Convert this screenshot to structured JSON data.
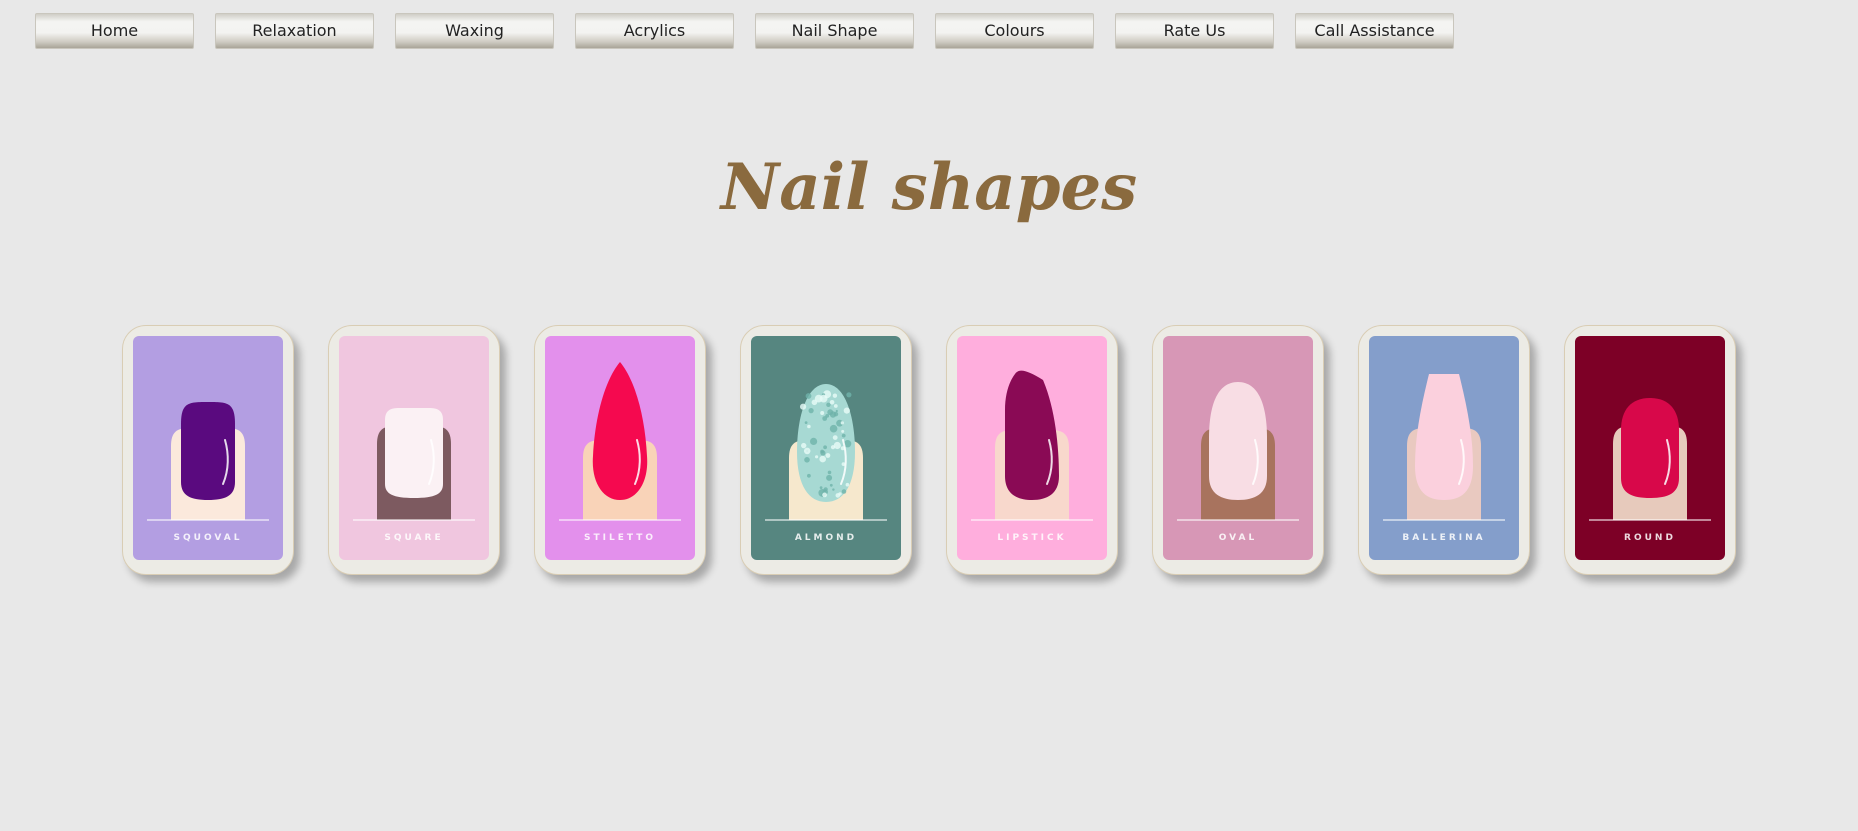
{
  "nav": {
    "items": [
      "Home",
      "Relaxation",
      "Waxing",
      "Acrylics",
      "Nail Shape",
      "Colours",
      "Rate Us",
      "Call Assistance"
    ]
  },
  "page_title": "Nail shapes",
  "shapes": [
    {
      "label": "SQUOVAL",
      "bg": "#b39ee2",
      "finger": "#fbe9dc",
      "nail": "#5a0a7f",
      "icon": "squoval-nail-icon"
    },
    {
      "label": "SQUARE",
      "bg": "#f0c6df",
      "finger": "#7d5a60",
      "nail": "#fbf1f4",
      "icon": "square-nail-icon"
    },
    {
      "label": "STILETTO",
      "bg": "#e390ec",
      "finger": "#f9d3b8",
      "nail": "#f5094f",
      "icon": "stiletto-nail-icon"
    },
    {
      "label": "ALMOND",
      "bg": "#568680",
      "finger": "#f6e8cd",
      "nail": "#a7d9d3",
      "icon": "almond-nail-icon"
    },
    {
      "label": "LIPSTICK",
      "bg": "#ffaedd",
      "finger": "#f8d8cc",
      "nail": "#8a0a55",
      "icon": "lipstick-nail-icon"
    },
    {
      "label": "OVAL",
      "bg": "#d797b6",
      "finger": "#a8735e",
      "nail": "#f8dde4",
      "icon": "oval-nail-icon"
    },
    {
      "label": "BALLERINA",
      "bg": "#849ecb",
      "finger": "#e9c9c0",
      "nail": "#fbd0dd",
      "icon": "ballerina-nail-icon"
    },
    {
      "label": "ROUND",
      "bg": "#7d0026",
      "finger": "#e7cabc",
      "nail": "#d8084a",
      "icon": "round-nail-icon"
    }
  ]
}
